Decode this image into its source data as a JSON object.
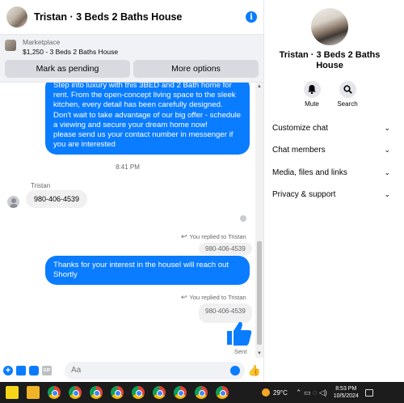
{
  "chat": {
    "title": "Tristan · 3 Beds 2 Baths House",
    "marketplace_label": "Marketplace",
    "listing": "$1,250 - 3 Beds 2 Baths House",
    "mark_pending_label": "Mark as pending",
    "more_options_label": "More options",
    "listing_message": "Step into luxury with this 3BED and 2 Bath home for rent. From the open-concept living space to the sleek kitchen, every detail has been carefully designed. Don't wait to take advantage of our big offer - schedule a viewing and secure your dream home now!\nplease  send us your contact number in messenger if you are interested",
    "timestamp": "8:41 PM",
    "sender_name": "Tristan",
    "incoming_message": "980-406-4539",
    "replied_label_1": "You replied to Tristan",
    "quoted_1": "980-406-4539",
    "reply_message": "Thanks for your interest in the houseI will reach out Shortly",
    "replied_label_2": "You replied to Tristan",
    "quoted_2": "980-406-4539",
    "sent_label": "Sent",
    "composer_placeholder": "Aa",
    "gif_label": "GIF"
  },
  "info": {
    "name": "Tristan · 3 Beds 2 Baths House",
    "mute_label": "Mute",
    "search_label": "Search",
    "sections": [
      "Customize chat",
      "Chat members",
      "Media, files and links",
      "Privacy & support"
    ]
  },
  "taskbar": {
    "temperature": "29°C",
    "time": "8:53 PM",
    "date": "10/5/2024"
  },
  "colors": {
    "accent": "#0a7cff",
    "gray_bubble": "#f0f0f0",
    "button_gray": "#d8dadf"
  }
}
